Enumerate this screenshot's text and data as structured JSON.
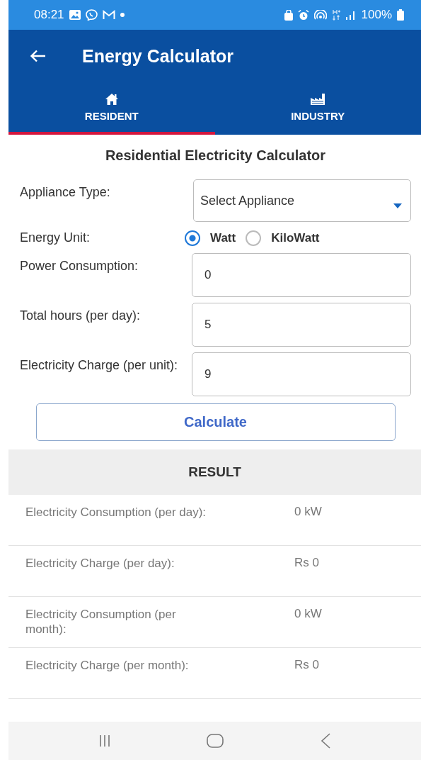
{
  "status_bar": {
    "time": "08:21",
    "battery": "100%"
  },
  "app_bar": {
    "title": "Energy Calculator"
  },
  "tabs": [
    {
      "label": "RESIDENT",
      "kind": "house",
      "selected": true
    },
    {
      "label": "INDUSTRY",
      "kind": "factory",
      "selected": false
    }
  ],
  "form": {
    "heading": "Residential Electricity Calculator",
    "appliance": {
      "label": "Appliance Type:",
      "placeholder": "Select Appliance"
    },
    "unit": {
      "label": "Energy Unit:",
      "options": [
        {
          "label": "Watt",
          "selected": true
        },
        {
          "label": "KiloWatt",
          "selected": false
        }
      ]
    },
    "fields": [
      {
        "label": "Power Consumption:",
        "value": "0"
      },
      {
        "label": "Total hours (per day):",
        "value": "5"
      },
      {
        "label": "Electricity Charge (per unit):",
        "value": "9"
      }
    ],
    "button": "Calculate"
  },
  "result": {
    "title": "RESULT",
    "rows": [
      {
        "label": "Electricity Consumption (per day):",
        "value": "0 kW"
      },
      {
        "label": "Electricity Charge (per day):",
        "value": "Rs 0"
      },
      {
        "label": "Electricity Consumption (per month):",
        "value": "0 kW"
      },
      {
        "label": "Electricity Charge (per month):",
        "value": "Rs 0"
      }
    ]
  }
}
